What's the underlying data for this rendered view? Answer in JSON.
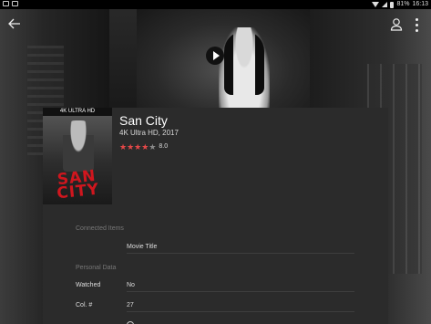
{
  "status_bar": {
    "battery": "81%",
    "time": "16:13"
  },
  "movie": {
    "title": "San City",
    "subtitle": "4K Ultra HD, 2017",
    "rating_value": "8.0",
    "rating_stars": 4,
    "rating_max": 5,
    "cover_badge": "4K ULTRA HD",
    "cover_title_line1": "SAN",
    "cover_title_line2": "CITY"
  },
  "sections": {
    "connected_items": {
      "label": "Connected Items",
      "value": "Movie Title"
    },
    "personal_data": {
      "label": "Personal Data",
      "rows": [
        {
          "label": "Watched",
          "value": "No"
        },
        {
          "label": "Col. #",
          "value": "27"
        }
      ]
    }
  },
  "colors": {
    "accent_star": "#e54848",
    "card_background": "#2b2b2b",
    "cover_title": "#d0161e"
  },
  "icons": {
    "back": "arrow-left",
    "profile": "person-outline",
    "more": "vertical-dots",
    "play": "play-triangle"
  }
}
